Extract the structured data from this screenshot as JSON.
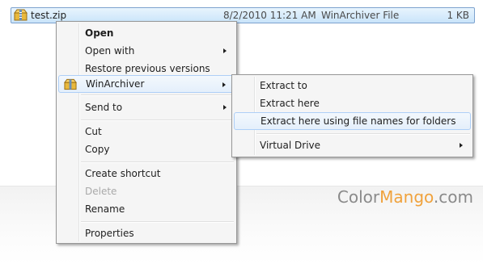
{
  "file": {
    "name": "test.zip",
    "date_modified": "8/2/2010 11:21 AM",
    "type": "WinArchiver File",
    "size": "1 KB",
    "icon": "zip-archive-icon"
  },
  "context_menu": {
    "items": [
      {
        "label": "Open"
      },
      {
        "label": "Open with"
      },
      {
        "label": "Restore previous versions"
      },
      {
        "label": "WinArchiver",
        "icon": "winarchiver-icon"
      },
      {
        "label": "Send to"
      },
      {
        "label": "Cut"
      },
      {
        "label": "Copy"
      },
      {
        "label": "Create shortcut"
      },
      {
        "label": "Delete"
      },
      {
        "label": "Rename"
      },
      {
        "label": "Properties"
      }
    ]
  },
  "submenu": {
    "items": [
      {
        "label": "Extract to"
      },
      {
        "label": "Extract here"
      },
      {
        "label": "Extract here using file names for folders"
      },
      {
        "label": "Virtual Drive"
      }
    ]
  },
  "watermark": {
    "part1": "Color",
    "part2": "Mango",
    "part3": ".com"
  },
  "colors": {
    "selection": "#c9e4fa",
    "hover_border": "#aecff7",
    "watermark_accent": "#f0a23c"
  }
}
